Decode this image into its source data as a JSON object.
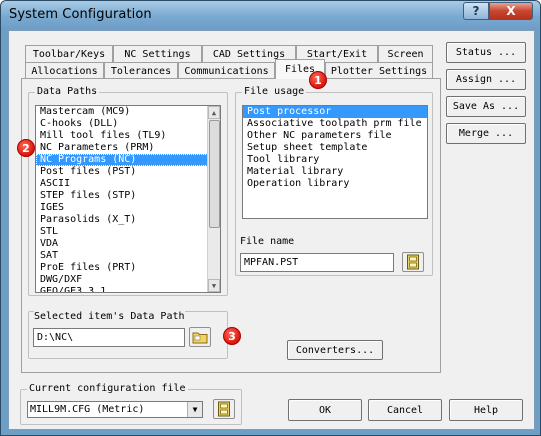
{
  "window": {
    "title": "System Configuration",
    "help_glyph": "?",
    "close_glyph": "X"
  },
  "tabs": {
    "row1": [
      "Toolbar/Keys",
      "NC Settings",
      "CAD Settings",
      "Start/Exit",
      "Screen"
    ],
    "row2": [
      "Allocations",
      "Tolerances",
      "Communications",
      "Files",
      "Plotter Settings"
    ],
    "active": "Files"
  },
  "side_buttons": {
    "status": "Status ...",
    "assign": "Assign ...",
    "save_as": "Save As ...",
    "merge": "Merge ..."
  },
  "data_paths": {
    "label": "Data Paths",
    "items": [
      "Mastercam (MC9)",
      "C-hooks (DLL)",
      "Mill tool files (TL9)",
      "NC Parameters (PRM)",
      "NC Programs (NC)",
      "Post files (PST)",
      "ASCII",
      "STEP files (STP)",
      "IGES",
      "Parasolids (X_T)",
      "STL",
      "VDA",
      "SAT",
      "ProE files (PRT)",
      "DWG/DXF",
      "GEO/GE3 3.1"
    ],
    "selected": "NC Programs (NC)"
  },
  "selected_path": {
    "label": "Selected item's Data Path",
    "value": "D:\\NC\\"
  },
  "file_usage": {
    "label": "File usage",
    "items": [
      "Post processor",
      "Associative toolpath prm file",
      "Other NC parameters file",
      "Setup sheet template",
      "Tool library",
      "Material library",
      "Operation library"
    ],
    "selected": "Post processor"
  },
  "file_name": {
    "label": "File name",
    "value": "MPFAN.PST"
  },
  "converters_button": "Converters...",
  "config": {
    "label": "Current configuration file",
    "value": "MILL9M.CFG (Metric)"
  },
  "footer_buttons": {
    "ok": "OK",
    "cancel": "Cancel",
    "help": "Help"
  },
  "badges": [
    "1",
    "2",
    "3"
  ],
  "colors": {
    "selection": "#3399ff",
    "badge": "#d8160a",
    "titlebar": "#7aa9d0"
  }
}
